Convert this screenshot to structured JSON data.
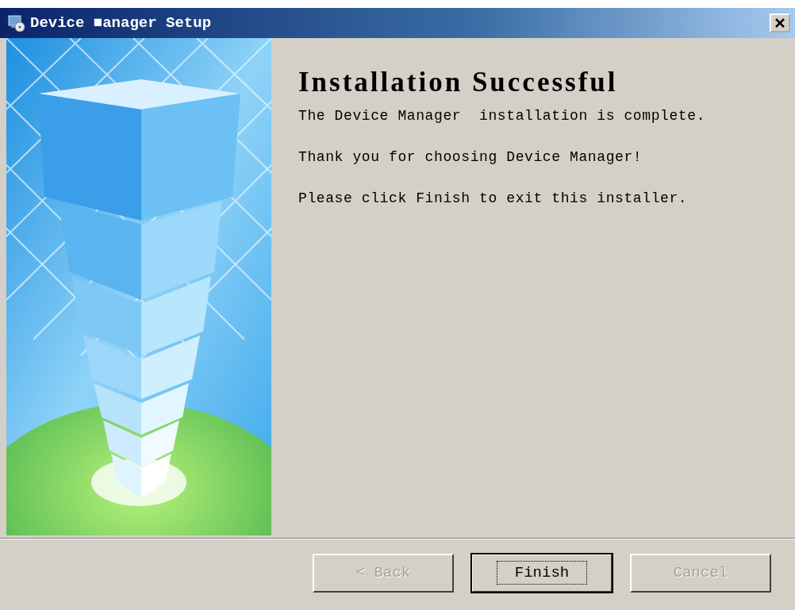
{
  "window": {
    "title": "Device ■anager Setup"
  },
  "heading": "Installation Successful",
  "messages": [
    "The Device Manager  installation is complete.",
    "Thank you for choosing Device Manager!",
    "Please click Finish to exit this installer."
  ],
  "buttons": [
    {
      "label": "< Back",
      "disabled": true,
      "default": false
    },
    {
      "label": "Finish",
      "disabled": false,
      "default": true
    },
    {
      "label": "Cancel",
      "disabled": true,
      "default": false
    }
  ]
}
